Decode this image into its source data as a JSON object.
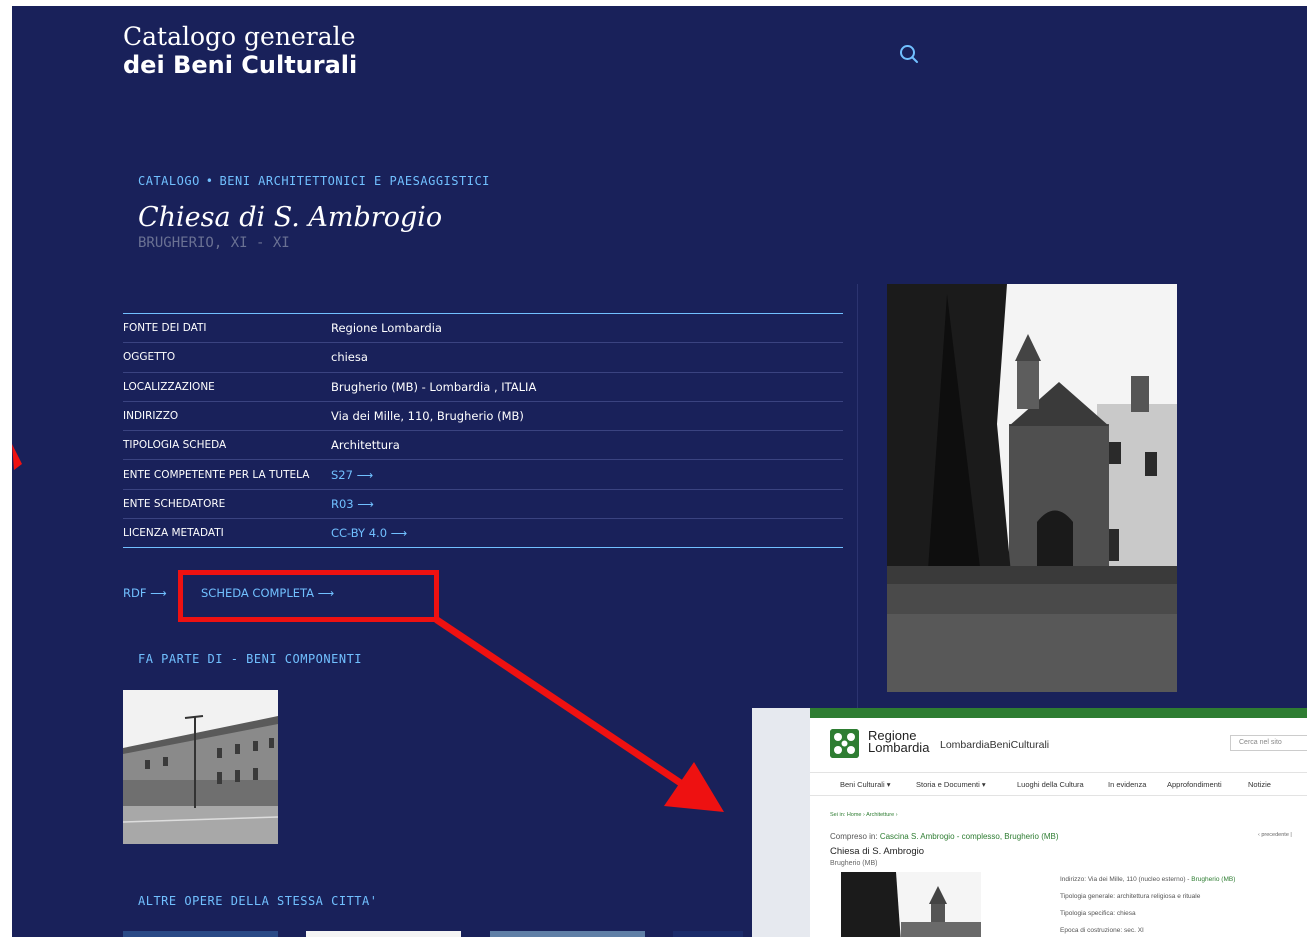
{
  "brand": {
    "line1": "Catalogo generale",
    "line2": "dei Beni Culturali"
  },
  "header": {
    "search_icon": "search-icon"
  },
  "breadcrumb": {
    "item1": "CATALOGO",
    "separator": "•",
    "item2": "BENI ARCHITETTONICI E PAESAGGISTICI"
  },
  "record": {
    "title": "Chiesa di S. Ambrogio",
    "subtitle": "BRUGHERIO, XI - XI"
  },
  "details": [
    {
      "label": "FONTE DEI DATI",
      "value": "Regione Lombardia",
      "link": false
    },
    {
      "label": "OGGETTO",
      "value": "chiesa",
      "link": false
    },
    {
      "label": "LOCALIZZAZIONE",
      "value": "Brugherio (MB) - Lombardia , ITALIA",
      "link": false
    },
    {
      "label": "INDIRIZZO",
      "value": "Via dei Mille, 110, Brugherio (MB)",
      "link": false
    },
    {
      "label": "TIPOLOGIA SCHEDA",
      "value": "Architettura",
      "link": false
    },
    {
      "label": "ENTE COMPETENTE PER LA TUTELA",
      "value": "S27 ⟶",
      "link": true
    },
    {
      "label": "ENTE SCHEDATORE",
      "value": "R03 ⟶",
      "link": true
    },
    {
      "label": "LICENZA METADATI",
      "value": "CC-BY 4.0 ⟶",
      "link": true
    }
  ],
  "links": {
    "rdf": "RDF ⟶",
    "full_record": "SCHEDA COMPLETA ⟶"
  },
  "sections": {
    "part_of": "FA PARTE DI - BENI COMPONENTI",
    "other_works": "ALTRE OPERE DELLA STESSA CITTA'"
  },
  "colors": {
    "background": "#19215a",
    "accent": "#71c0ff",
    "highlight": "#ee1111",
    "inset_green": "#2e7d32"
  },
  "inset": {
    "org_line1": "Regione",
    "org_line2": "Lombardia",
    "site_name": "LombardiaBeniCulturali",
    "search_placeholder": "Cerca nel sito",
    "nav": [
      "Beni Culturali  ▾",
      "Storia e Documenti  ▾",
      "Luoghi della Cultura",
      "In evidenza",
      "Approfondimenti",
      "Notizie"
    ],
    "breadcrumb": "Sei in: Home › Architetture ›",
    "part_of_label": "Compreso in:",
    "part_of_link": "Cascina S. Ambrogio - complesso, Brugherio (MB)",
    "prev": "‹ precedente |",
    "title": "Chiesa di S. Ambrogio",
    "place": "Brugherio (MB)",
    "address_label": "Indirizzo:",
    "address_value": "Via dei Mille, 110 (nucleo esterno) -",
    "address_link": "Brugherio (MB)",
    "type_general_label": "Tipologia generale:",
    "type_general_value": "architettura religiosa e rituale",
    "type_specific_label": "Tipologia specifica:",
    "type_specific_value": "chiesa",
    "epoch_label": "Epoca di costruzione:",
    "epoch_value": "sec. XI"
  }
}
